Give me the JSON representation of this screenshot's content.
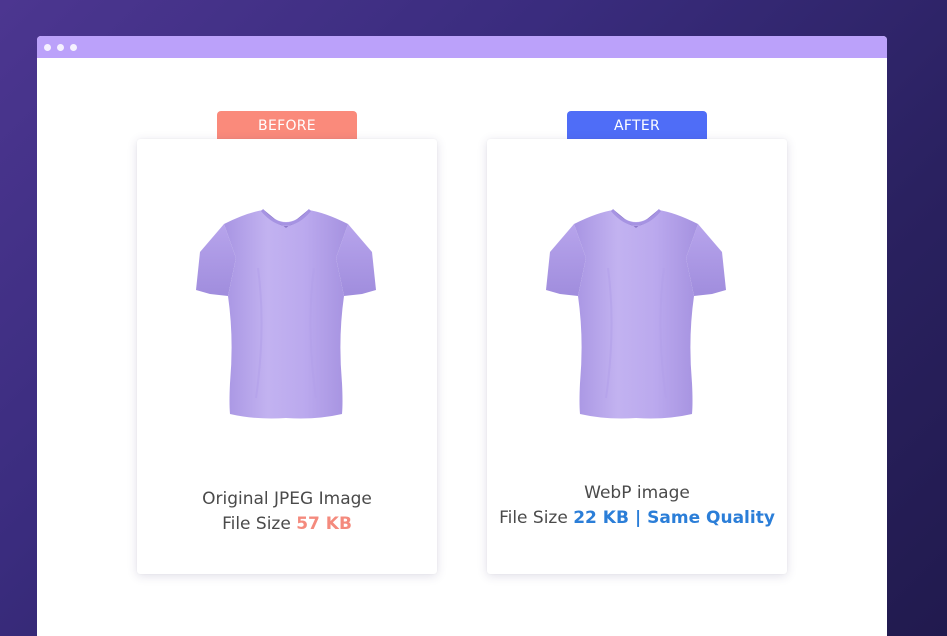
{
  "colors": {
    "titlebar": "#bba1fa",
    "before_tag": "#fa8a7b",
    "after_tag": "#4f6df7",
    "before_size": "#f48a7d",
    "after_highlight": "#2b7ed8",
    "shirt": "#b9a6ea"
  },
  "window": {
    "controls": [
      "dot",
      "dot",
      "dot"
    ]
  },
  "before": {
    "tag": "BEFORE",
    "image_icon": "tshirt-icon",
    "line1": "Original JPEG Image",
    "size_label": "File Size",
    "size_value": "57 KB"
  },
  "after": {
    "tag": "AFTER",
    "image_icon": "tshirt-icon",
    "line1": "WebP image",
    "size_label": "File Size",
    "size_value": "22 KB",
    "separator": "|",
    "quality": "Same Quality"
  }
}
